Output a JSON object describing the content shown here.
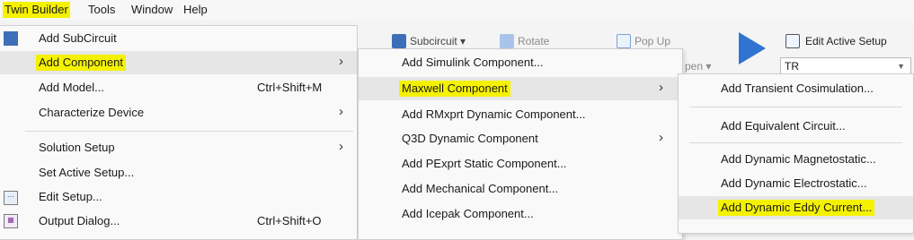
{
  "menubar": {
    "items": [
      {
        "label": "Twin Builder"
      },
      {
        "label": "Tools"
      },
      {
        "label": "Window"
      },
      {
        "label": "Help"
      }
    ]
  },
  "ribbon": {
    "subcircuit_label": "Subcircuit",
    "rotate_label": "Rotate",
    "popup_label": "Pop Up",
    "open_label": "pen",
    "edit_active_setup_label": "Edit Active Setup",
    "active_setup_value": "TR"
  },
  "menu1": {
    "items": [
      {
        "label": "Add SubCircuit",
        "shortcut": "",
        "submenu": false
      },
      {
        "label": "Add Component",
        "shortcut": "",
        "submenu": true
      },
      {
        "label": "Add Model...",
        "shortcut": "Ctrl+Shift+M",
        "submenu": false
      },
      {
        "label": "Characterize Device",
        "shortcut": "",
        "submenu": true
      },
      {
        "label": "Solution Setup",
        "shortcut": "",
        "submenu": true
      },
      {
        "label": "Set Active Setup...",
        "shortcut": "",
        "submenu": false
      },
      {
        "label": "Edit Setup...",
        "shortcut": "",
        "submenu": false
      },
      {
        "label": "Output Dialog...",
        "shortcut": "Ctrl+Shift+O",
        "submenu": false
      }
    ]
  },
  "menu2": {
    "items": [
      {
        "label": "Add Simulink Component..."
      },
      {
        "label": "Maxwell Component"
      },
      {
        "label": "Add RMxprt Dynamic Component..."
      },
      {
        "label": "Q3D Dynamic Component"
      },
      {
        "label": "Add PExprt Static Component..."
      },
      {
        "label": "Add Mechanical Component..."
      },
      {
        "label": "Add Icepak Component..."
      }
    ]
  },
  "menu3": {
    "items": [
      {
        "label": "Add Transient Cosimulation..."
      },
      {
        "label": "Add Equivalent Circuit..."
      },
      {
        "label": "Add Dynamic Magnetostatic..."
      },
      {
        "label": "Add Dynamic Electrostatic..."
      },
      {
        "label": "Add Dynamic Eddy Current..."
      }
    ]
  },
  "colors": {
    "highlight": "#f5f200",
    "selected_row": "#e6e6e6",
    "play_button": "#2f74d0"
  }
}
